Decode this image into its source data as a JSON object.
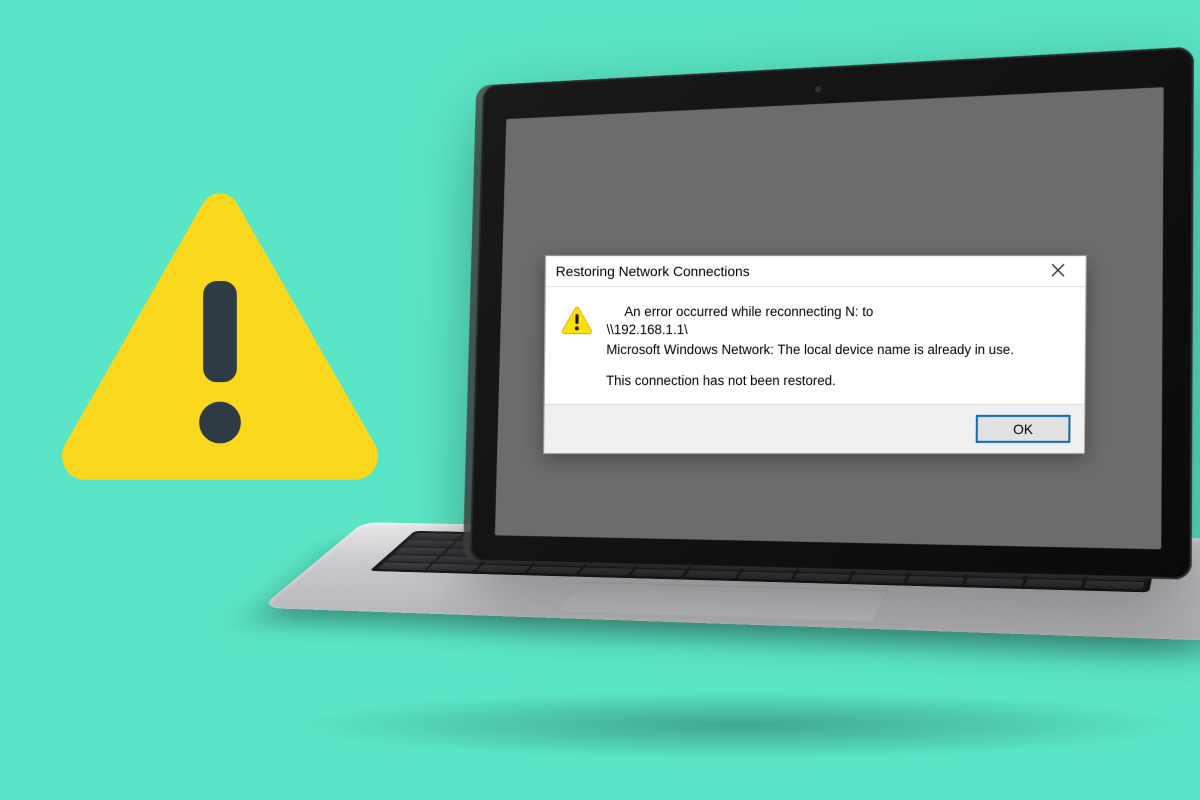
{
  "dialog": {
    "title": "Restoring Network Connections",
    "line1": "An error occurred while reconnecting N: to",
    "line2": "\\\\192.168.1.1\\",
    "line3": "Microsoft Windows Network: The local device name is already in use.",
    "line4": "This connection has not been restored.",
    "ok_label": "OK",
    "close_label": "✕"
  },
  "colors": {
    "background": "#5AE6C6",
    "warning_yellow": "#F9D71C",
    "warning_dark": "#2E3A44"
  }
}
